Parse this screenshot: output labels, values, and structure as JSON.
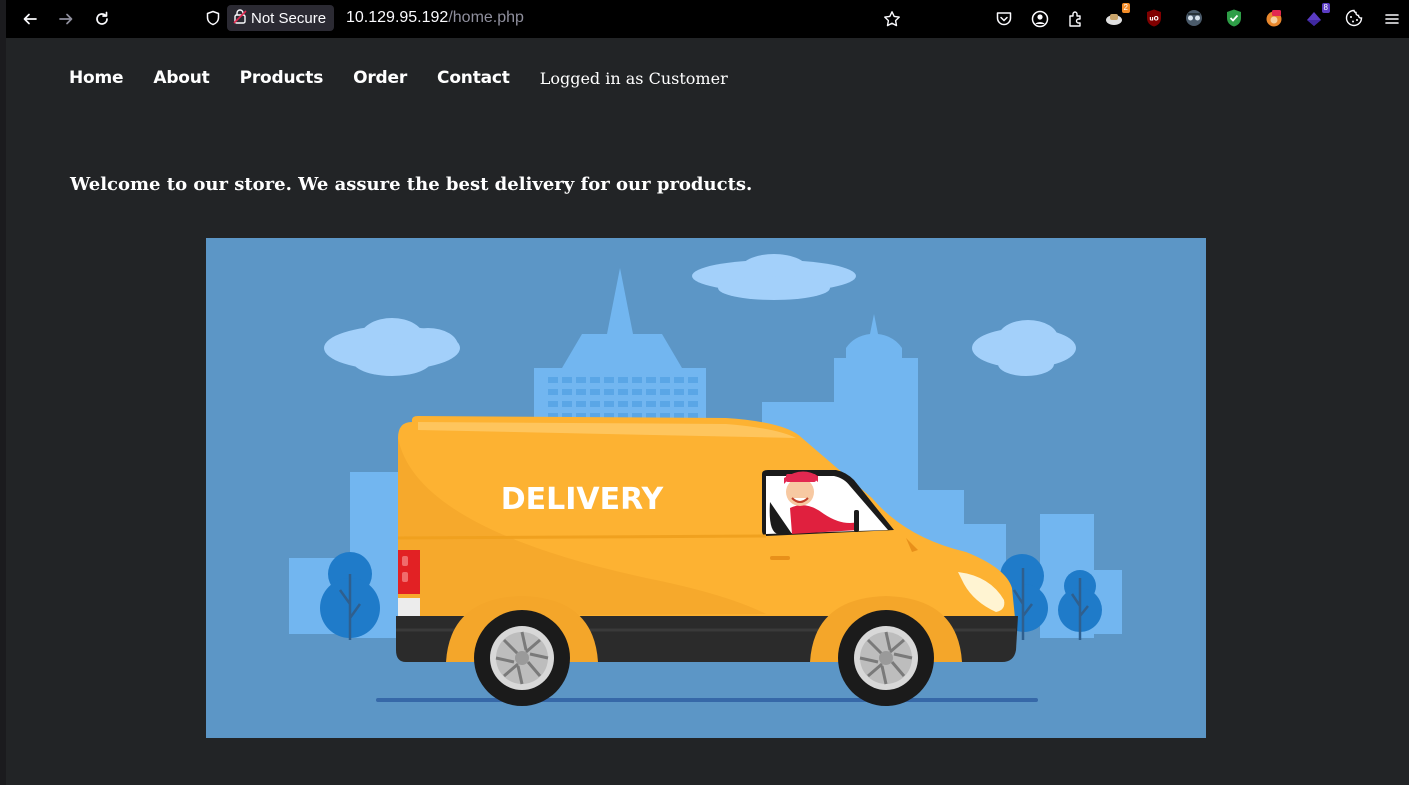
{
  "browser": {
    "security_label": "Not Secure",
    "url_host": "10.129.95.192",
    "url_path": "/home.php",
    "icons": {
      "back": "back-arrow-icon",
      "forward": "forward-arrow-icon",
      "reload": "reload-icon",
      "shield": "tracking-shield-icon",
      "lock": "insecure-lock-icon",
      "bookmark": "bookmark-star-icon",
      "pocket": "pocket-icon",
      "account": "account-icon",
      "extensions": "extensions-icon",
      "menu": "hamburger-menu-icon"
    },
    "extension_badges": {
      "ext1": "2",
      "ext8": "8"
    }
  },
  "nav": {
    "items": [
      {
        "label": "Home"
      },
      {
        "label": "About"
      },
      {
        "label": "Products"
      },
      {
        "label": "Order"
      },
      {
        "label": "Contact"
      }
    ],
    "status": "Logged in as Customer"
  },
  "main": {
    "welcome": "Welcome to our store. We assure the best delivery for our products.",
    "hero": {
      "van_text": "DELIVERY",
      "background": "#5c96c6",
      "van_color": "#fdb232"
    }
  }
}
